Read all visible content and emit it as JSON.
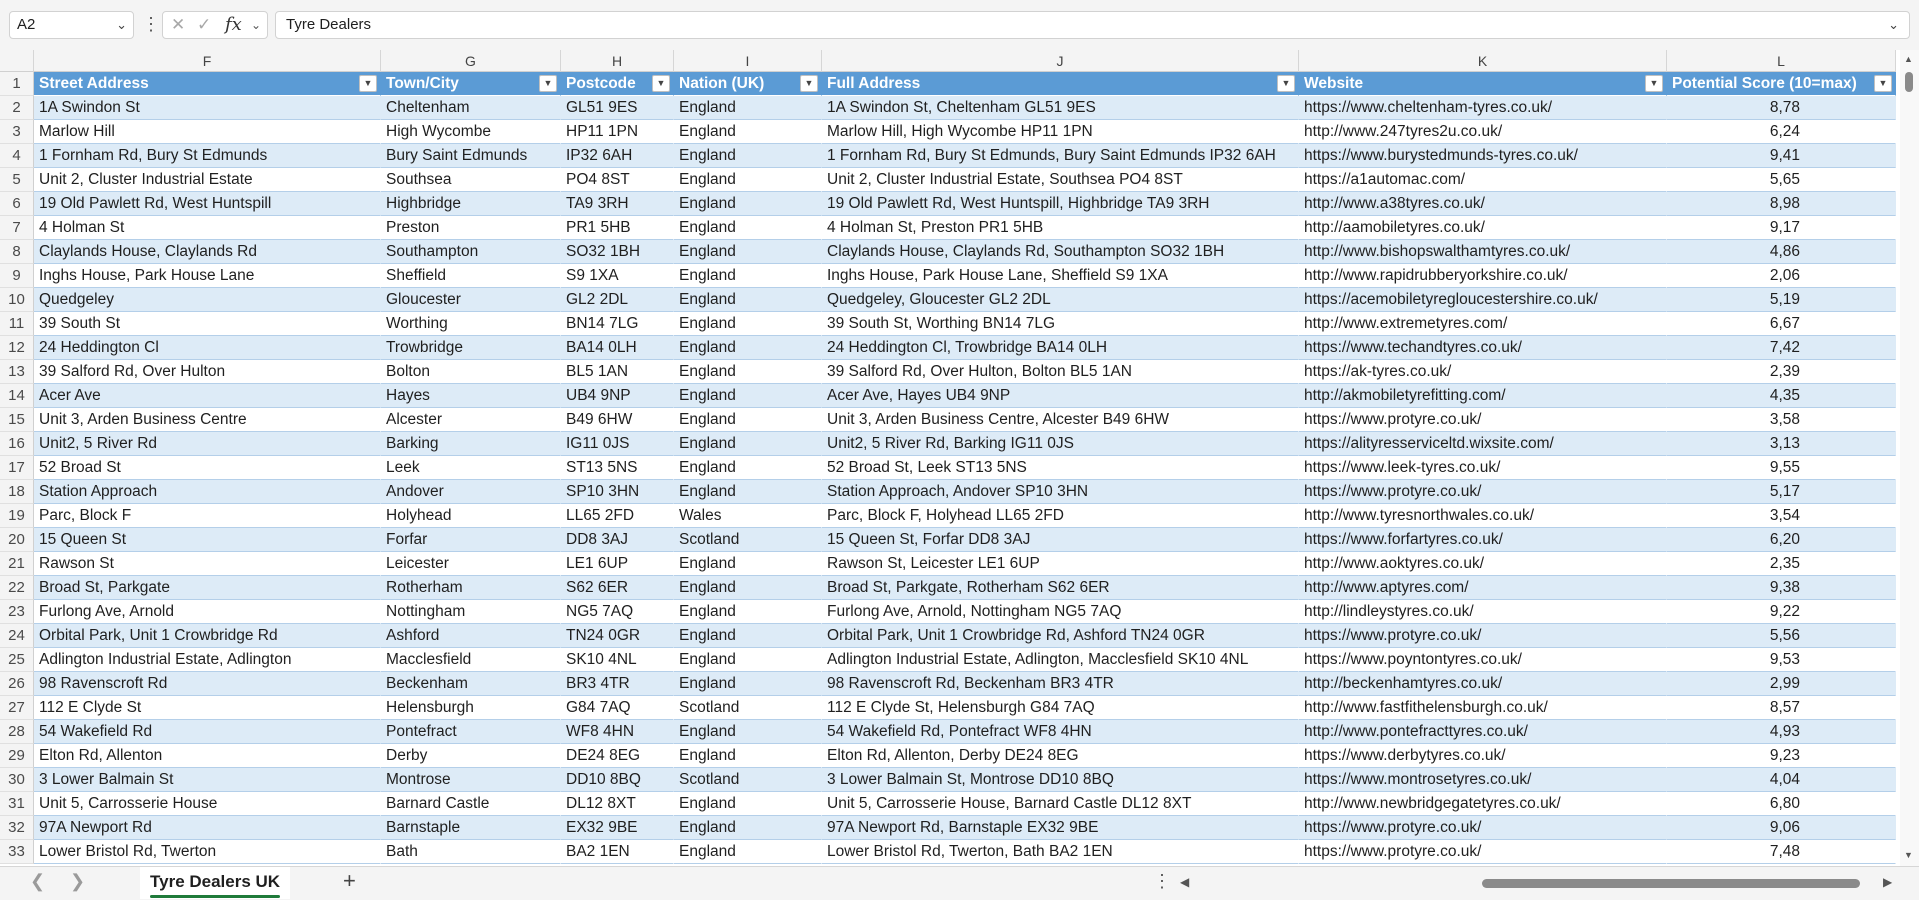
{
  "formula_bar": {
    "name_box": "A2",
    "formula": "Tyre Dealers",
    "fx_label": "fx"
  },
  "columns": [
    {
      "letter": "F",
      "header": "Street Address"
    },
    {
      "letter": "G",
      "header": "Town/City"
    },
    {
      "letter": "H",
      "header": "Postcode"
    },
    {
      "letter": "I",
      "header": "Nation (UK)"
    },
    {
      "letter": "J",
      "header": "Full Address"
    },
    {
      "letter": "K",
      "header": "Website"
    },
    {
      "letter": "L",
      "header": "Potential Score (10=max)"
    }
  ],
  "header_row_number": "1",
  "rows": [
    {
      "n": "2",
      "street": "1A Swindon St",
      "town": "Cheltenham",
      "postcode": "GL51 9ES",
      "nation": "England",
      "full": "1A Swindon St, Cheltenham GL51 9ES",
      "website": "https://www.cheltenham-tyres.co.uk/",
      "score": "8,78"
    },
    {
      "n": "3",
      "street": "Marlow Hill",
      "town": "High Wycombe",
      "postcode": "HP11 1PN",
      "nation": "England",
      "full": "Marlow Hill, High Wycombe HP11 1PN",
      "website": "http://www.247tyres2u.co.uk/",
      "score": "6,24"
    },
    {
      "n": "4",
      "street": "1 Fornham Rd, Bury St Edmunds",
      "town": "Bury Saint Edmunds",
      "postcode": "IP32 6AH",
      "nation": "England",
      "full": "1 Fornham Rd, Bury St Edmunds, Bury Saint Edmunds IP32 6AH",
      "website": "https://www.burystedmunds-tyres.co.uk/",
      "score": "9,41"
    },
    {
      "n": "5",
      "street": "Unit 2, Cluster Industrial Estate",
      "town": "Southsea",
      "postcode": "PO4 8ST",
      "nation": "England",
      "full": "Unit 2, Cluster Industrial Estate, Southsea PO4 8ST",
      "website": "https://a1automac.com/",
      "score": "5,65"
    },
    {
      "n": "6",
      "street": "19 Old Pawlett Rd, West Huntspill",
      "town": "Highbridge",
      "postcode": "TA9 3RH",
      "nation": "England",
      "full": "19 Old Pawlett Rd, West Huntspill, Highbridge TA9 3RH",
      "website": "http://www.a38tyres.co.uk/",
      "score": "8,98"
    },
    {
      "n": "7",
      "street": "4 Holman St",
      "town": "Preston",
      "postcode": "PR1 5HB",
      "nation": "England",
      "full": "4 Holman St, Preston PR1 5HB",
      "website": "http://aamobiletyres.co.uk/",
      "score": "9,17"
    },
    {
      "n": "8",
      "street": "Claylands House, Claylands Rd",
      "town": "Southampton",
      "postcode": "SO32 1BH",
      "nation": "England",
      "full": "Claylands House, Claylands Rd, Southampton SO32 1BH",
      "website": "http://www.bishopswalthamtyres.co.uk/",
      "score": "4,86"
    },
    {
      "n": "9",
      "street": "Inghs House, Park House Lane",
      "town": "Sheffield",
      "postcode": "S9 1XA",
      "nation": "England",
      "full": "Inghs House, Park House Lane, Sheffield S9 1XA",
      "website": "http://www.rapidrubberyorkshire.co.uk/",
      "score": "2,06"
    },
    {
      "n": "10",
      "street": "Quedgeley",
      "town": "Gloucester",
      "postcode": "GL2 2DL",
      "nation": "England",
      "full": "Quedgeley, Gloucester GL2 2DL",
      "website": "https://acemobiletyregloucestershire.co.uk/",
      "score": "5,19"
    },
    {
      "n": "11",
      "street": "39 South St",
      "town": "Worthing",
      "postcode": "BN14 7LG",
      "nation": "England",
      "full": "39 South St, Worthing BN14 7LG",
      "website": "http://www.extremetyres.com/",
      "score": "6,67"
    },
    {
      "n": "12",
      "street": "24 Heddington Cl",
      "town": "Trowbridge",
      "postcode": "BA14 0LH",
      "nation": "England",
      "full": "24 Heddington Cl, Trowbridge BA14 0LH",
      "website": "https://www.techandtyres.co.uk/",
      "score": "7,42"
    },
    {
      "n": "13",
      "street": "39 Salford Rd, Over Hulton",
      "town": "Bolton",
      "postcode": "BL5 1AN",
      "nation": "England",
      "full": "39 Salford Rd, Over Hulton, Bolton BL5 1AN",
      "website": "https://ak-tyres.co.uk/",
      "score": "2,39"
    },
    {
      "n": "14",
      "street": "Acer Ave",
      "town": "Hayes",
      "postcode": "UB4 9NP",
      "nation": "England",
      "full": "Acer Ave, Hayes UB4 9NP",
      "website": "http://akmobiletyrefitting.com/",
      "score": "4,35"
    },
    {
      "n": "15",
      "street": "Unit 3, Arden Business Centre",
      "town": "Alcester",
      "postcode": "B49 6HW",
      "nation": "England",
      "full": "Unit 3, Arden Business Centre, Alcester B49 6HW",
      "website": "https://www.protyre.co.uk/",
      "score": "3,58"
    },
    {
      "n": "16",
      "street": "Unit2, 5 River Rd",
      "town": "Barking",
      "postcode": "IG11 0JS",
      "nation": "England",
      "full": "Unit2, 5 River Rd, Barking IG11 0JS",
      "website": "https://alityresserviceltd.wixsite.com/",
      "score": "3,13"
    },
    {
      "n": "17",
      "street": "52 Broad St",
      "town": "Leek",
      "postcode": "ST13 5NS",
      "nation": "England",
      "full": "52 Broad St, Leek ST13 5NS",
      "website": "https://www.leek-tyres.co.uk/",
      "score": "9,55"
    },
    {
      "n": "18",
      "street": "Station Approach",
      "town": "Andover",
      "postcode": "SP10 3HN",
      "nation": "England",
      "full": "Station Approach, Andover SP10 3HN",
      "website": "https://www.protyre.co.uk/",
      "score": "5,17"
    },
    {
      "n": "19",
      "street": "Parc, Block F",
      "town": "Holyhead",
      "postcode": "LL65 2FD",
      "nation": "Wales",
      "full": "Parc, Block F, Holyhead LL65 2FD",
      "website": "http://www.tyresnorthwales.co.uk/",
      "score": "3,54"
    },
    {
      "n": "20",
      "street": "15 Queen St",
      "town": "Forfar",
      "postcode": "DD8 3AJ",
      "nation": "Scotland",
      "full": "15 Queen St, Forfar DD8 3AJ",
      "website": "https://www.forfartyres.co.uk/",
      "score": "6,20"
    },
    {
      "n": "21",
      "street": "Rawson St",
      "town": "Leicester",
      "postcode": "LE1 6UP",
      "nation": "England",
      "full": "Rawson St, Leicester LE1 6UP",
      "website": "http://www.aoktyres.co.uk/",
      "score": "2,35"
    },
    {
      "n": "22",
      "street": "Broad St, Parkgate",
      "town": "Rotherham",
      "postcode": "S62 6ER",
      "nation": "England",
      "full": "Broad St, Parkgate, Rotherham S62 6ER",
      "website": "http://www.aptyres.com/",
      "score": "9,38"
    },
    {
      "n": "23",
      "street": "Furlong Ave, Arnold",
      "town": "Nottingham",
      "postcode": "NG5 7AQ",
      "nation": "England",
      "full": "Furlong Ave, Arnold, Nottingham NG5 7AQ",
      "website": "http://lindleystyres.co.uk/",
      "score": "9,22"
    },
    {
      "n": "24",
      "street": "Orbital Park, Unit 1 Crowbridge Rd",
      "town": "Ashford",
      "postcode": "TN24 0GR",
      "nation": "England",
      "full": "Orbital Park, Unit 1 Crowbridge Rd, Ashford TN24 0GR",
      "website": "https://www.protyre.co.uk/",
      "score": "5,56"
    },
    {
      "n": "25",
      "street": "Adlington Industrial Estate, Adlington",
      "town": "Macclesfield",
      "postcode": "SK10 4NL",
      "nation": "England",
      "full": "Adlington Industrial Estate, Adlington, Macclesfield SK10 4NL",
      "website": "https://www.poyntontyres.co.uk/",
      "score": "9,53"
    },
    {
      "n": "26",
      "street": "98 Ravenscroft Rd",
      "town": "Beckenham",
      "postcode": "BR3 4TR",
      "nation": "England",
      "full": "98 Ravenscroft Rd, Beckenham BR3 4TR",
      "website": "http://beckenhamtyres.co.uk/",
      "score": "2,99"
    },
    {
      "n": "27",
      "street": "112 E Clyde St",
      "town": "Helensburgh",
      "postcode": "G84 7AQ",
      "nation": "Scotland",
      "full": "112 E Clyde St, Helensburgh G84 7AQ",
      "website": "http://www.fastfithelensburgh.co.uk/",
      "score": "8,57"
    },
    {
      "n": "28",
      "street": "54 Wakefield Rd",
      "town": "Pontefract",
      "postcode": "WF8 4HN",
      "nation": "England",
      "full": "54 Wakefield Rd, Pontefract WF8 4HN",
      "website": "http://www.pontefracttyres.co.uk/",
      "score": "4,93"
    },
    {
      "n": "29",
      "street": "Elton Rd, Allenton",
      "town": "Derby",
      "postcode": "DE24 8EG",
      "nation": "England",
      "full": "Elton Rd, Allenton, Derby DE24 8EG",
      "website": "https://www.derbytyres.co.uk/",
      "score": "9,23"
    },
    {
      "n": "30",
      "street": "3 Lower Balmain St",
      "town": "Montrose",
      "postcode": "DD10 8BQ",
      "nation": "Scotland",
      "full": "3 Lower Balmain St, Montrose DD10 8BQ",
      "website": "https://www.montrosetyres.co.uk/",
      "score": "4,04"
    },
    {
      "n": "31",
      "street": "Unit 5, Carrosserie House",
      "town": "Barnard Castle",
      "postcode": "DL12 8XT",
      "nation": "England",
      "full": "Unit 5, Carrosserie House, Barnard Castle DL12 8XT",
      "website": "http://www.newbridgegatetyres.co.uk/",
      "score": "6,80"
    },
    {
      "n": "32",
      "street": "97A Newport Rd",
      "town": "Barnstaple",
      "postcode": "EX32 9BE",
      "nation": "England",
      "full": "97A Newport Rd, Barnstaple EX32 9BE",
      "website": "https://www.protyre.co.uk/",
      "score": "9,06"
    },
    {
      "n": "33",
      "street": "Lower Bristol Rd, Twerton",
      "town": "Bath",
      "postcode": "BA2 1EN",
      "nation": "England",
      "full": "Lower Bristol Rd, Twerton, Bath BA2 1EN",
      "website": "https://www.protyre.co.uk/",
      "score": "7,48"
    }
  ],
  "sheet_tab": "Tyre Dealers UK",
  "colors": {
    "header_blue": "#5b9bd5",
    "band_light": "#ddebf7",
    "tab_green": "#1f7a3a"
  }
}
